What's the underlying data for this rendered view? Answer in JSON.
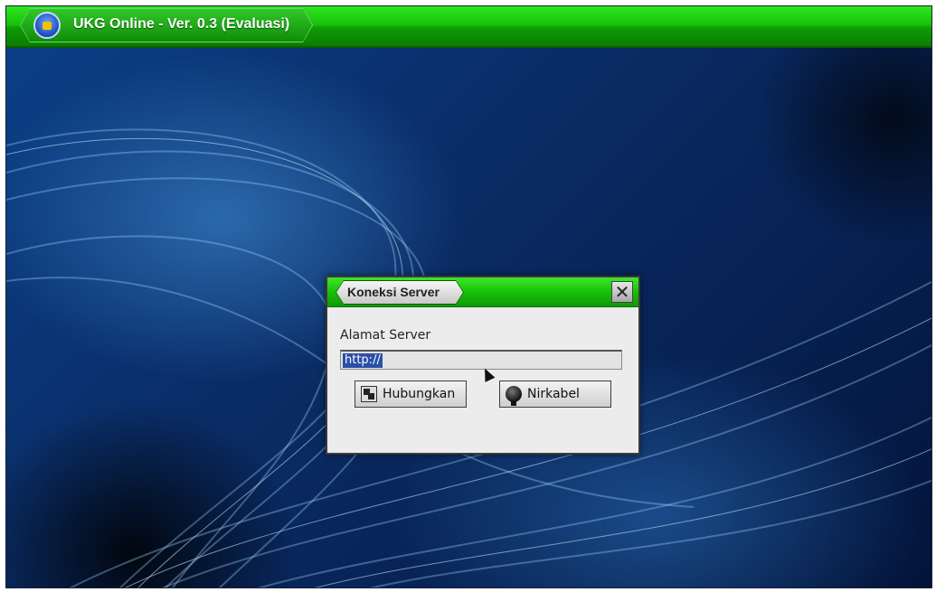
{
  "app": {
    "title": "UKG Online - Ver. 0.3 (Evaluasi)",
    "logo_icon": "education-emblem-icon"
  },
  "dialog": {
    "title": "Koneksi Server",
    "close_icon": "close-icon",
    "field_label": "Alamat Server",
    "server_address_value": "http://",
    "buttons": {
      "connect_label": "Hubungkan",
      "connect_icon": "network-connect-icon",
      "wireless_label": "Nirkabel",
      "wireless_icon": "wireless-icon"
    }
  },
  "colors": {
    "titlebar_green": "#19c20c",
    "background_blue": "#0a2c66",
    "dialog_body": "#ececec",
    "selection": "#2a4fa8"
  }
}
